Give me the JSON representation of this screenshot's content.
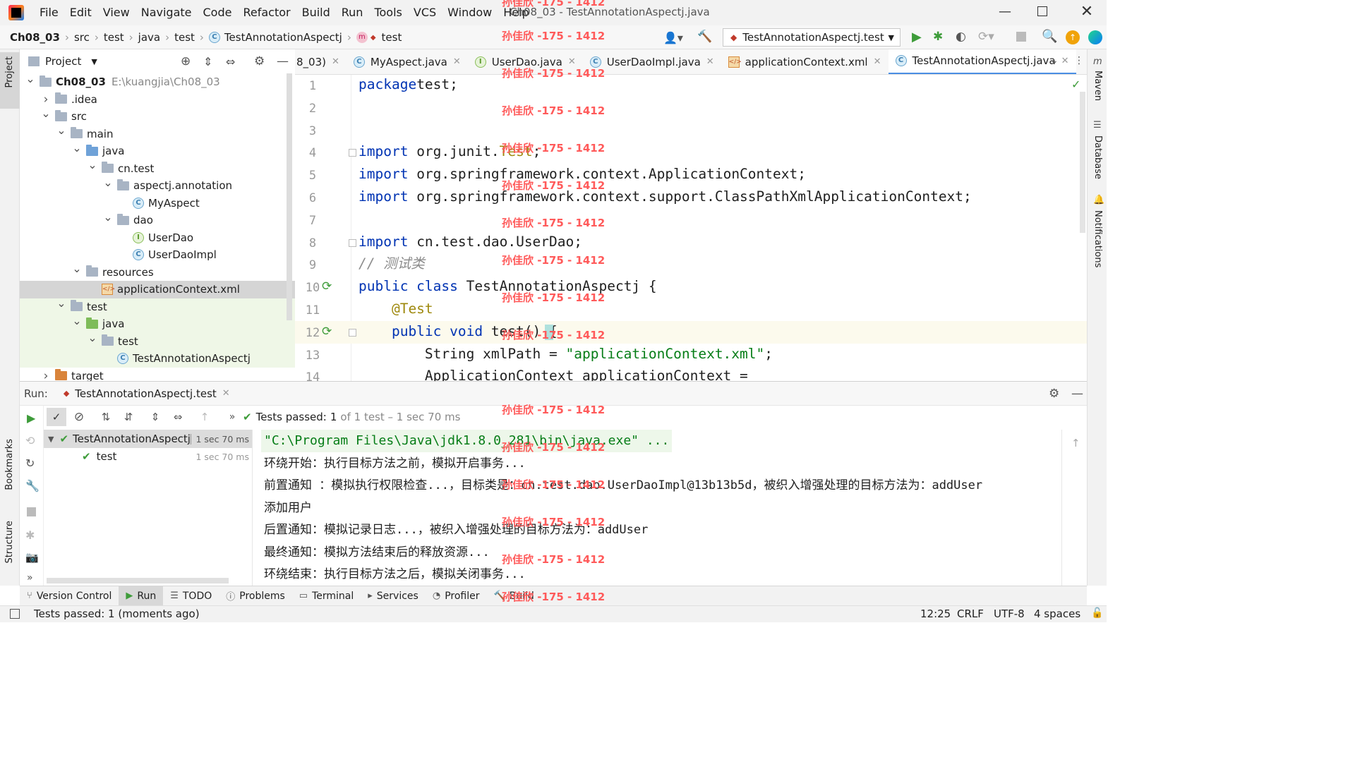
{
  "window": {
    "title": "Ch08_03 - TestAnnotationAspectj.java",
    "menu": [
      "File",
      "Edit",
      "View",
      "Navigate",
      "Code",
      "Refactor",
      "Build",
      "Run",
      "Tools",
      "VCS",
      "Window",
      "Help"
    ]
  },
  "breadcrumb": [
    "Ch08_03",
    "src",
    "test",
    "java",
    "test",
    "TestAnnotationAspectj",
    "test"
  ],
  "run_config": "TestAnnotationAspectj.test",
  "watermark": "孙佳欣 -175 - 1412",
  "project": {
    "header": "Project",
    "tree": [
      {
        "label": "Ch08_03",
        "extra": "E:\\kuangjia\\Ch08_03",
        "depth": 0,
        "icon": "folder",
        "open": true,
        "bold": true
      },
      {
        "label": ".idea",
        "depth": 1,
        "icon": "folder",
        "open": false
      },
      {
        "label": "src",
        "depth": 1,
        "icon": "folder",
        "open": true
      },
      {
        "label": "main",
        "depth": 2,
        "icon": "folder",
        "open": true
      },
      {
        "label": "java",
        "depth": 3,
        "icon": "folder-blue",
        "open": true
      },
      {
        "label": "cn.test",
        "depth": 4,
        "icon": "package",
        "open": true
      },
      {
        "label": "aspectj.annotation",
        "depth": 5,
        "icon": "package",
        "open": true
      },
      {
        "label": "MyAspect",
        "depth": 6,
        "icon": "class"
      },
      {
        "label": "dao",
        "depth": 5,
        "icon": "package",
        "open": true
      },
      {
        "label": "UserDao",
        "depth": 6,
        "icon": "interface"
      },
      {
        "label": "UserDaoImpl",
        "depth": 6,
        "icon": "class"
      },
      {
        "label": "resources",
        "depth": 3,
        "icon": "folder-res",
        "open": true
      },
      {
        "label": "applicationContext.xml",
        "depth": 4,
        "icon": "xml",
        "selected": true
      },
      {
        "label": "test",
        "depth": 2,
        "icon": "folder",
        "open": true,
        "test": true
      },
      {
        "label": "java",
        "depth": 3,
        "icon": "folder-green",
        "open": true,
        "test": true
      },
      {
        "label": "test",
        "depth": 4,
        "icon": "package",
        "open": true,
        "test": true
      },
      {
        "label": "TestAnnotationAspectj",
        "depth": 5,
        "icon": "class",
        "test": true
      },
      {
        "label": "target",
        "depth": 1,
        "icon": "folder-orange",
        "open": false
      }
    ]
  },
  "tabs": [
    {
      "label": "8_03)",
      "icon": "none"
    },
    {
      "label": "MyAspect.java",
      "icon": "class"
    },
    {
      "label": "UserDao.java",
      "icon": "interface"
    },
    {
      "label": "UserDaoImpl.java",
      "icon": "class"
    },
    {
      "label": "applicationContext.xml",
      "icon": "xml"
    },
    {
      "label": "TestAnnotationAspectj.java",
      "icon": "class",
      "active": true
    }
  ],
  "code": {
    "line_numbers": [
      "1",
      "2",
      "3",
      "4",
      "5",
      "6",
      "7",
      "8",
      "9",
      "10",
      "11",
      "12",
      "13",
      "14"
    ],
    "lines": [
      [
        [
          "kw",
          "package"
        ],
        [
          "",
          "test;"
        ]
      ],
      [],
      [],
      [
        [
          "kw",
          "import"
        ],
        [
          "",
          " org.junit."
        ],
        [
          "ann",
          "Test"
        ],
        [
          "",
          ";"
        ]
      ],
      [
        [
          "kw",
          "import"
        ],
        [
          "",
          " org.springframework.context.ApplicationContext;"
        ]
      ],
      [
        [
          "kw",
          "import"
        ],
        [
          "",
          " org.springframework.context.support.ClassPathXmlApplicationContext;"
        ]
      ],
      [],
      [
        [
          "kw",
          "import"
        ],
        [
          "",
          " cn.test.dao.UserDao;"
        ]
      ],
      [
        [
          "cmt",
          "// 测试类"
        ]
      ],
      [
        [
          "kw",
          "public class"
        ],
        [
          "",
          " TestAnnotationAspectj {"
        ]
      ],
      [
        [
          "ann",
          "    @Test"
        ]
      ],
      [
        [
          "kw",
          "    public void"
        ],
        [
          "",
          " test() {"
        ]
      ],
      [
        [
          "",
          "        String xmlPath = "
        ],
        [
          "str",
          "\"applicationContext.xml\""
        ],
        [
          "",
          ";"
        ]
      ],
      [
        [
          "",
          "        ApplicationContext applicationContext ="
        ]
      ]
    ]
  },
  "run": {
    "label": "Run:",
    "tab": "TestAnnotationAspectj.test",
    "status": "Tests passed:",
    "passed": "1",
    "status_rest": "of 1 test – 1 sec 70 ms",
    "tests": [
      {
        "name": "TestAnnotationAspectj",
        "time": "1 sec 70 ms"
      },
      {
        "name": "test",
        "time": "1 sec 70 ms"
      }
    ],
    "console": [
      "\"C:\\Program Files\\Java\\jdk1.8.0_281\\bin\\java.exe\" ...",
      "环绕开始：执行目标方法之前，模拟开启事务...",
      "前置通知 ：模拟执行权限检查...，目标类是：cn.test.dao.UserDaoImpl@13b13b5d，被织入增强处理的目标方法为：addUser",
      "添加用户",
      "后置通知：模拟记录日志...，被织入增强处理的目标方法为：addUser",
      "最终通知：模拟方法结束后的释放资源...",
      "环绕结束：执行目标方法之后，模拟关闭事务..."
    ]
  },
  "bottom_tabs": [
    "Version Control",
    "Run",
    "TODO",
    "Problems",
    "Terminal",
    "Services",
    "Profiler",
    "Build"
  ],
  "status_bar": {
    "message": "Tests passed: 1 (moments ago)",
    "position": "12:25",
    "line_sep": "CRLF",
    "encoding": "UTF-8",
    "indent": "4 spaces"
  },
  "right_tools": [
    "Maven",
    "Database",
    "Notifications"
  ],
  "left_tools": [
    "Project",
    "Bookmarks",
    "Structure"
  ]
}
